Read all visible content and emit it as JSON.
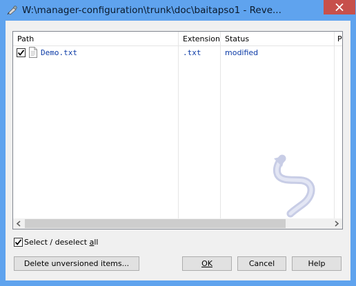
{
  "window": {
    "title": "W:\\manager-configuration\\trunk\\doc\\baitapso1 - Reve...",
    "title_icon": "tortoisesvn-revert-icon",
    "close_icon": "close-icon"
  },
  "list": {
    "columns": [
      "Path",
      "Extension",
      "Status",
      "P"
    ],
    "rows": [
      {
        "checked": true,
        "file_icon": "text-file-icon",
        "path": "Demo.txt",
        "extension": ".txt",
        "status": "modified"
      }
    ]
  },
  "select_all": {
    "checked": true,
    "label_prefix": "Select / deselect ",
    "label_accel": "a",
    "label_suffix": "ll"
  },
  "buttons": {
    "delete_unversioned": "Delete unversioned items...",
    "ok": "OK",
    "cancel": "Cancel",
    "help": "Help"
  },
  "colors": {
    "title_bar": "#5fa3ee",
    "close_button": "#c7504b",
    "link_text": "#0b3aa6"
  }
}
